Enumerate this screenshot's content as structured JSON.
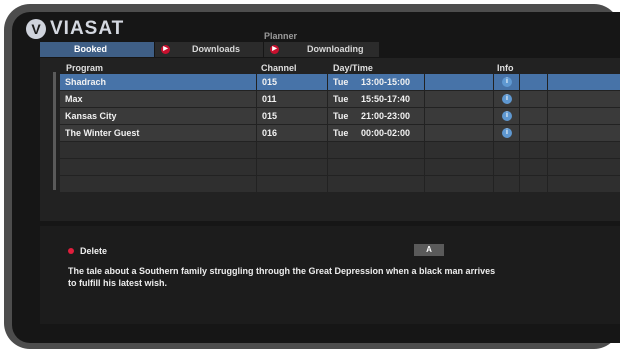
{
  "brand": {
    "logo_letter": "V",
    "name": "VIASAT"
  },
  "section_title": "Planner",
  "tabs": [
    {
      "label": "Booked",
      "active": true,
      "has_icon": false
    },
    {
      "label": "Downloads",
      "active": false,
      "has_icon": true
    },
    {
      "label": "Downloading",
      "active": false,
      "has_icon": true
    }
  ],
  "tab_icon_name": "rec-icon",
  "columns": {
    "program": "Program",
    "channel": "Channel",
    "daytime": "Day/Time",
    "info": "Info"
  },
  "rows": [
    {
      "program": "Shadrach",
      "channel": "015",
      "day": "Tue",
      "time": "13:00-15:00",
      "info_icon": "i",
      "selected": true
    },
    {
      "program": "Max",
      "channel": "011",
      "day": "Tue",
      "time": "15:50-17:40",
      "info_icon": "i",
      "selected": false
    },
    {
      "program": "Kansas City",
      "channel": "015",
      "day": "Tue",
      "time": "21:00-23:00",
      "info_icon": "i",
      "selected": false
    },
    {
      "program": "The Winter Guest",
      "channel": "016",
      "day": "Tue",
      "time": "00:00-02:00",
      "info_icon": "i",
      "selected": false
    }
  ],
  "empty_rows": 3,
  "actions": {
    "delete_label": "Delete",
    "a_button_label": "A"
  },
  "description": "The tale about a Southern family struggling through the Great Depression when a black man arrives to fulfill his latest wish.",
  "colors": {
    "accent_blue": "#4773a8",
    "delete_red": "#e01e3c",
    "info_blue": "#5f98d1"
  }
}
